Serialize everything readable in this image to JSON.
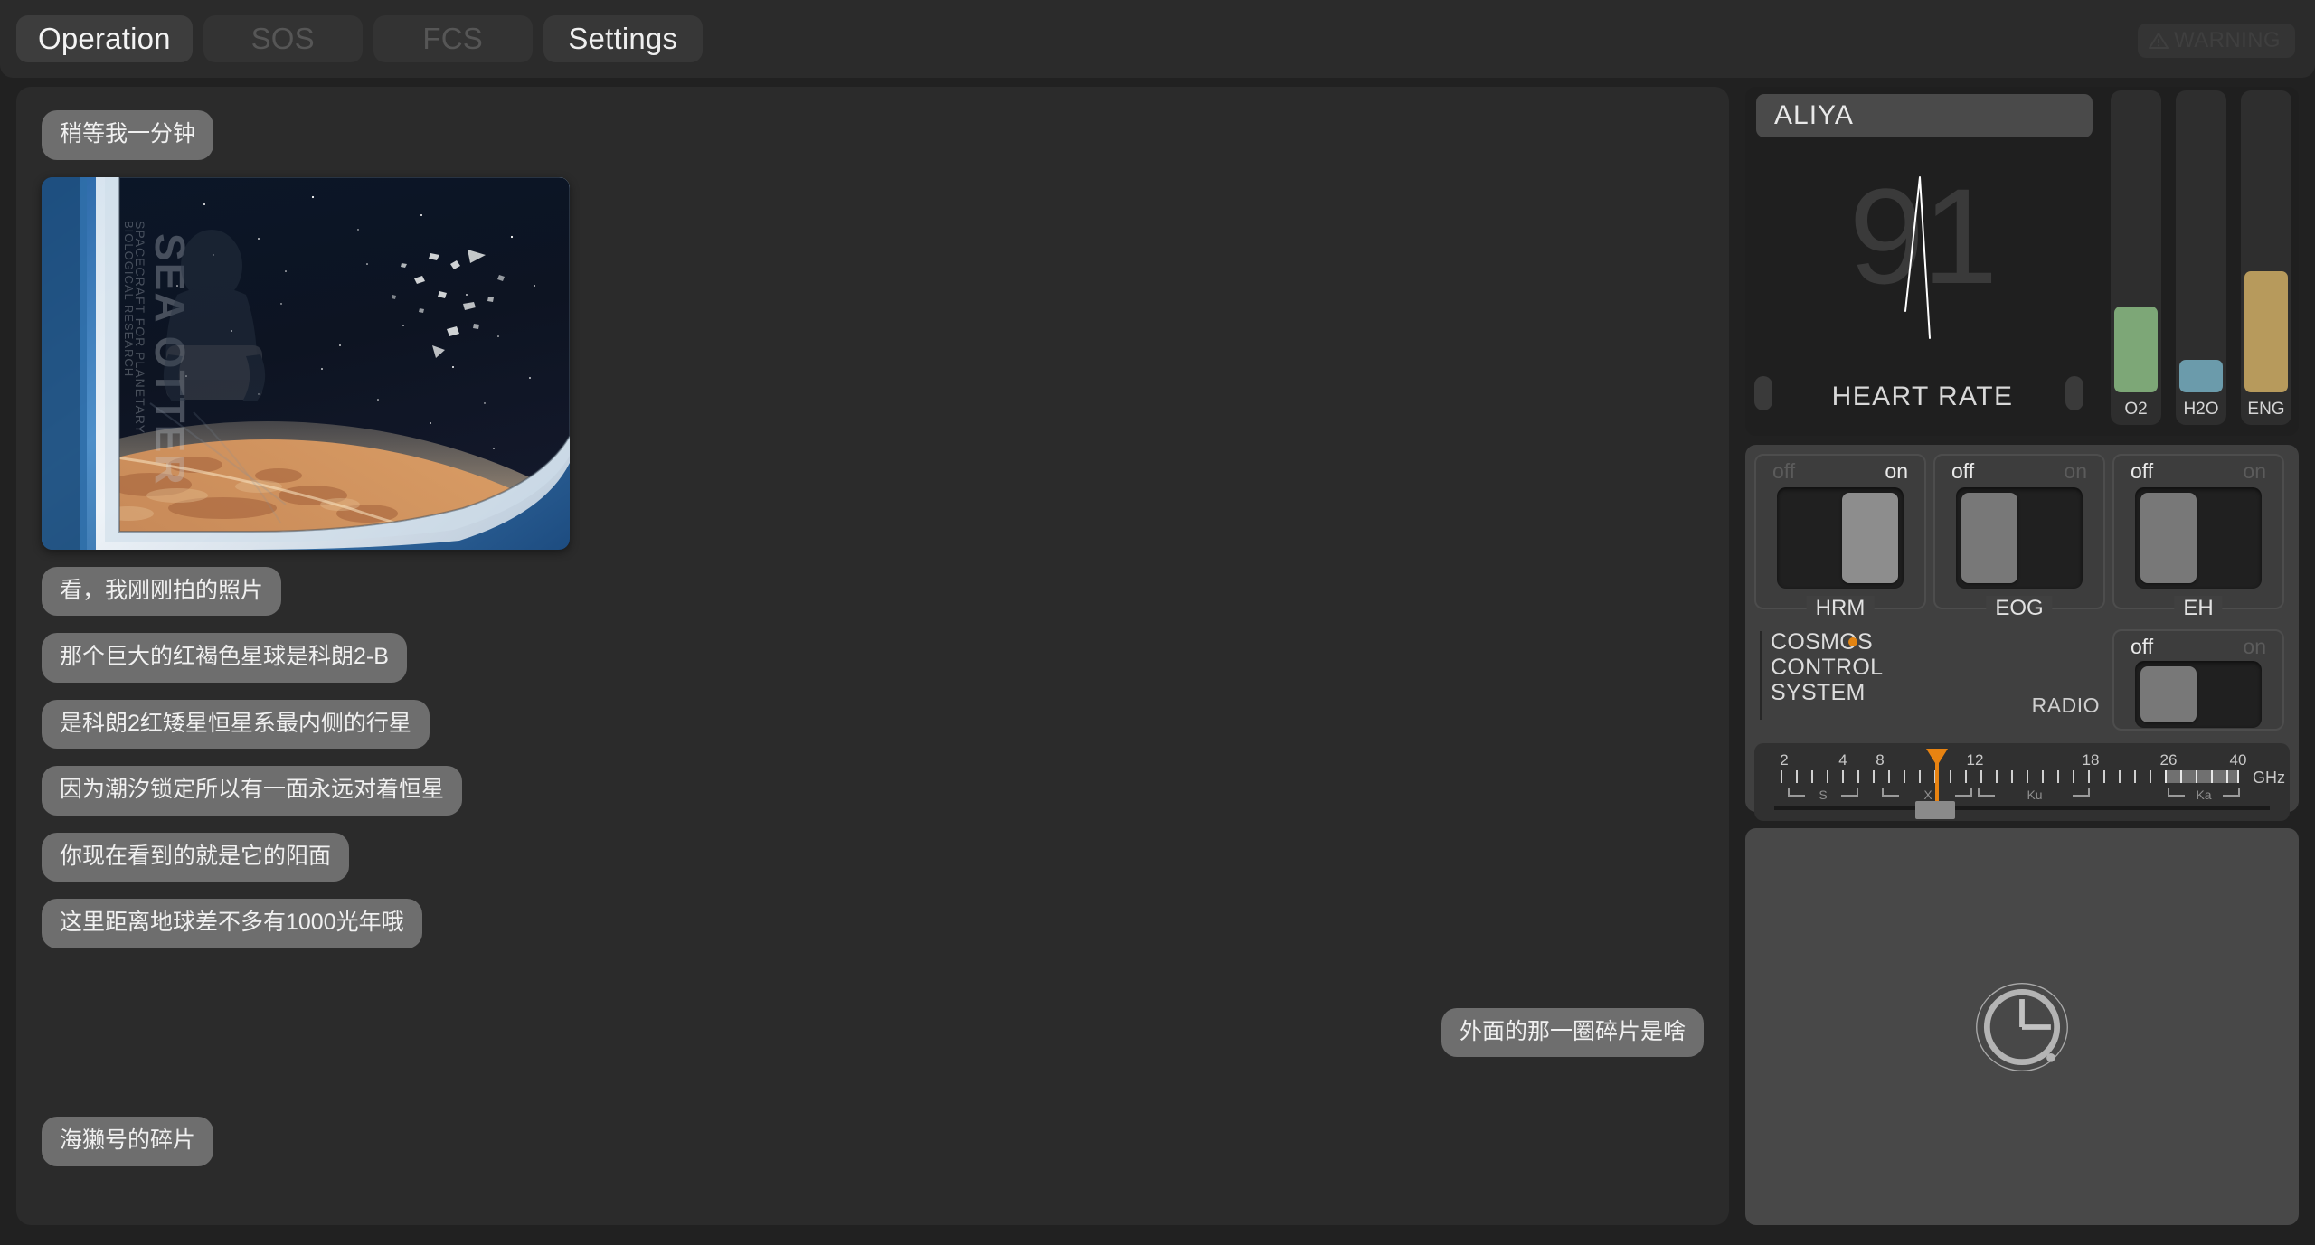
{
  "topbar": {
    "tabs": [
      {
        "label": "Operation",
        "state": "selected"
      },
      {
        "label": "SOS",
        "state": "dim"
      },
      {
        "label": "FCS",
        "state": "dim"
      },
      {
        "label": "Settings",
        "state": "normal"
      }
    ],
    "warning_label": "WARNING"
  },
  "chat": {
    "messages": [
      {
        "side": "left",
        "type": "text",
        "text": "稍等我一分钟"
      },
      {
        "side": "left",
        "type": "image",
        "alt": "spacecraft-window-planet-photo"
      },
      {
        "side": "left",
        "type": "text",
        "text": "看，我刚刚拍的照片"
      },
      {
        "side": "left",
        "type": "text",
        "text": "那个巨大的红褐色星球是科朗2-B"
      },
      {
        "side": "left",
        "type": "text",
        "text": "是科朗2红矮星恒星系最内侧的行星"
      },
      {
        "side": "left",
        "type": "text",
        "text": "因为潮汐锁定所以有一面永远对着恒星"
      },
      {
        "side": "left",
        "type": "text",
        "text": "你现在看到的就是它的阳面"
      },
      {
        "side": "left",
        "type": "text",
        "text": "这里距离地球差不多有1000光年哦"
      },
      {
        "side": "right",
        "type": "text",
        "text": "外面的那一圈碎片是啥"
      },
      {
        "side": "left",
        "type": "text",
        "text": "海獭号的碎片"
      }
    ],
    "photo": {
      "ship_name": "SEA OTTER",
      "ship_subtitle_1": "SPACECRAFT FOR PLANETARY",
      "ship_subtitle_2": "BIOLOGICAL RESEARCH"
    }
  },
  "vitals": {
    "name": "ALIYA",
    "heart_rate_value": "91",
    "heart_rate_label": "HEART RATE",
    "prev_label": "",
    "next_label": "",
    "gauges": [
      {
        "name": "O2",
        "percent": 29,
        "color": "#7da777"
      },
      {
        "name": "H2O",
        "percent": 11,
        "color": "#6b9bab"
      },
      {
        "name": "ENG",
        "percent": 41,
        "color": "#b79a5c"
      }
    ]
  },
  "toggles": [
    {
      "name": "HRM",
      "off_label": "off",
      "on_label": "on",
      "state": "on"
    },
    {
      "name": "EOG",
      "off_label": "off",
      "on_label": "on",
      "state": "off"
    },
    {
      "name": "EH",
      "off_label": "off",
      "on_label": "on",
      "state": "off"
    }
  ],
  "cosmos": {
    "line1": "COSMOS",
    "line2": "CONTROL",
    "line3": "SYSTEM",
    "radio_label": "RADIO",
    "radio_toggle": {
      "off_label": "off",
      "on_label": "on",
      "state": "off"
    },
    "accent_color": "#e28413"
  },
  "frequency": {
    "unit": "GHz",
    "tick_labels": [
      "2",
      "4",
      "8",
      "12",
      "18",
      "26",
      "40"
    ],
    "tick_positions_pct": [
      5,
      17.5,
      27.5,
      44.5,
      69.5,
      84.5,
      96.5
    ],
    "bands": [
      {
        "label": "S",
        "start_pct": 5,
        "end_pct": 17.5
      },
      {
        "label": "X",
        "start_pct": 27.5,
        "end_pct": 44.5
      },
      {
        "label": "Ku",
        "start_pct": 47,
        "end_pct": 69.5
      },
      {
        "label": "Ka",
        "start_pct": 84.5,
        "end_pct": 96.5
      }
    ],
    "needle_pct": 36,
    "handle_pct": 36,
    "selected_range_pct": [
      84.5,
      96.5
    ]
  },
  "clock": {
    "icon": "clock-orbit-icon"
  }
}
